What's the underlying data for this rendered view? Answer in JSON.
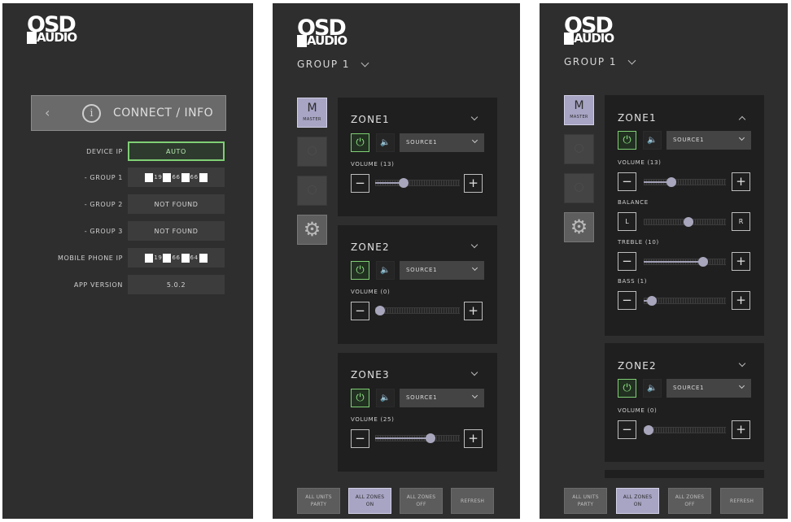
{
  "brand": {
    "line1": "OSD",
    "line2": "AUDIO"
  },
  "info_screen": {
    "header_label": "CONNECT / INFO",
    "rows": [
      {
        "label": "DEVICE IP",
        "value": "AUTO"
      },
      {
        "label": "- GROUP 1",
        "ip": [
          "19",
          "66",
          "66"
        ]
      },
      {
        "label": "- GROUP 2",
        "value": "NOT FOUND"
      },
      {
        "label": "- GROUP 3",
        "value": "NOT FOUND"
      },
      {
        "label": "MOBILE PHONE IP",
        "ip": [
          "19",
          "66",
          "64"
        ]
      },
      {
        "label": "APP VERSION",
        "value": "5.0.2"
      }
    ]
  },
  "group_title": "GROUP 1",
  "master_button": {
    "letter": "M",
    "label": "MASTER"
  },
  "zones_screen": {
    "zones": [
      {
        "name": "ZONE1",
        "source": "SOURCE1",
        "volume_label": "VOLUME (13)",
        "volume_fraction": 0.31
      },
      {
        "name": "ZONE2",
        "source": "SOURCE1",
        "volume_label": "VOLUME (0)",
        "volume_fraction": 0.0
      },
      {
        "name": "ZONE3",
        "source": "SOURCE1",
        "volume_label": "VOLUME (25)",
        "volume_fraction": 0.67
      }
    ]
  },
  "zone_detail_screen": {
    "zone1": {
      "name": "ZONE1",
      "source": "SOURCE1",
      "volume_label": "VOLUME (13)",
      "volume_fraction": 0.31,
      "balance_label": "BALANCE",
      "balance_fraction": 0.55,
      "balance_left": "L",
      "balance_right": "R",
      "treble_label": "TREBLE (10)",
      "treble_fraction": 0.75,
      "bass_label": "BASS (1)",
      "bass_fraction": 0.05
    },
    "zone2": {
      "name": "ZONE2",
      "source": "SOURCE1",
      "volume_label": "VOLUME (0)",
      "volume_fraction": 0.0
    }
  },
  "bottom_buttons": [
    {
      "line1": "ALL UNITS",
      "line2": "PARTY",
      "active": false
    },
    {
      "line1": "ALL ZONES",
      "line2": "ON",
      "active": true
    },
    {
      "line1": "ALL ZONES",
      "line2": "OFF",
      "active": false
    },
    {
      "line1": "REFRESH",
      "line2": "",
      "active": false
    }
  ],
  "colors": {
    "panel_bg": "#2e2e2e",
    "zone_bg": "#1f1f1f",
    "power_on": "#7fcf74",
    "accent": "#a7a4c4"
  },
  "icons": {
    "back": "chevron-left-icon",
    "info": "info-circle-icon",
    "power": "power-icon",
    "mute": "speaker-icon",
    "settings": "gear-icon"
  }
}
